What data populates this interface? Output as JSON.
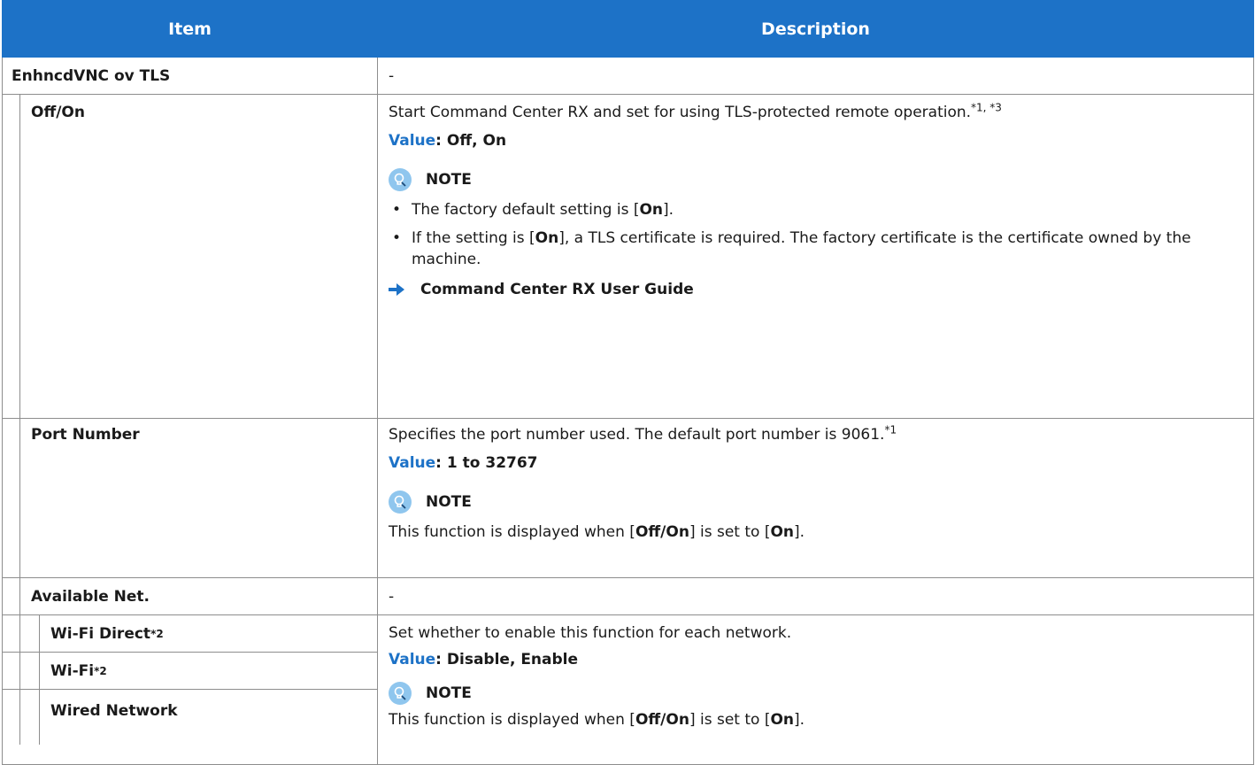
{
  "header": {
    "item": "Item",
    "description": "Description"
  },
  "rows": {
    "vnc": {
      "label": "EnhncdVNC ov TLS",
      "desc": "-"
    },
    "offon": {
      "label": "Off/On",
      "desc": "Start Command Center RX and set for using TLS-protected remote operation.",
      "sup": "*1, *3",
      "value_label": "Value",
      "value": ": Off, On",
      "note_title": "NOTE",
      "notes": [
        {
          "a": "The factory default setting is [",
          "b": "On",
          "c": "]."
        },
        {
          "a": "If the setting is [",
          "b": "On",
          "c": "], a TLS certificate is required. The factory certificate is the certificate owned by the machine."
        }
      ],
      "ref": "Command Center RX User Guide"
    },
    "port": {
      "label": "Port Number",
      "desc": "Specifies the port number used. The default port number is 9061.",
      "sup": "*1",
      "value_label": "Value",
      "value": ": 1 to 32767",
      "note_title": "NOTE",
      "note": {
        "a": "This function is displayed when [",
        "b": "Off/On",
        "c": "] is set to [",
        "d": "On",
        "e": "]."
      }
    },
    "avail": {
      "label": "Available Net.",
      "desc": "-"
    },
    "networks": {
      "items": [
        {
          "label": "Wi-Fi Direct",
          "sup": "*2"
        },
        {
          "label": "Wi-Fi",
          "sup": "*2"
        },
        {
          "label": "Wired Network",
          "sup": ""
        }
      ],
      "desc": "Set whether to enable this function for each network.",
      "value_label": "Value",
      "value": ": Disable, Enable",
      "note_title": "NOTE",
      "note": {
        "a": "This function is displayed when [",
        "b": "Off/On",
        "c": "] is set to [",
        "d": "On",
        "e": "]."
      }
    }
  },
  "colors": {
    "header_bg": "#1d72c7",
    "value_label": "#1d72c7",
    "note_icon": "#8fc6ee",
    "border": "#8d8d8d"
  },
  "icons": {
    "note": "note-lightbulb-icon",
    "reference": "arrow-right-icon"
  }
}
